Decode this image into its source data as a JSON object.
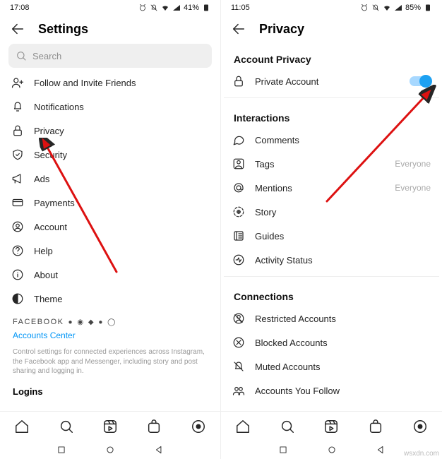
{
  "left": {
    "status": {
      "time": "17:08",
      "battery": "41%"
    },
    "header": {
      "title": "Settings"
    },
    "search": {
      "placeholder": "Search"
    },
    "items": [
      {
        "label": "Follow and Invite Friends"
      },
      {
        "label": "Notifications"
      },
      {
        "label": "Privacy"
      },
      {
        "label": "Security"
      },
      {
        "label": "Ads"
      },
      {
        "label": "Payments"
      },
      {
        "label": "Account"
      },
      {
        "label": "Help"
      },
      {
        "label": "About"
      },
      {
        "label": "Theme"
      }
    ],
    "brand_label": "FACEBOOK",
    "accounts_center": "Accounts Center",
    "footer_text": "Control settings for connected experiences across Instagram, the Facebook app and Messenger, including story and post sharing and logging in.",
    "logins_label": "Logins"
  },
  "right": {
    "status": {
      "time": "11:05",
      "battery": "85%"
    },
    "header": {
      "title": "Privacy"
    },
    "section_account_privacy": "Account Privacy",
    "private_account": {
      "label": "Private Account",
      "on": true
    },
    "section_interactions": "Interactions",
    "interactions": [
      {
        "label": "Comments",
        "meta": ""
      },
      {
        "label": "Tags",
        "meta": "Everyone"
      },
      {
        "label": "Mentions",
        "meta": "Everyone"
      },
      {
        "label": "Story",
        "meta": ""
      },
      {
        "label": "Guides",
        "meta": ""
      },
      {
        "label": "Activity Status",
        "meta": ""
      }
    ],
    "section_connections": "Connections",
    "connections": [
      {
        "label": "Restricted Accounts"
      },
      {
        "label": "Blocked Accounts"
      },
      {
        "label": "Muted Accounts"
      },
      {
        "label": "Accounts You Follow"
      }
    ]
  },
  "watermark": "wsxdn.com"
}
